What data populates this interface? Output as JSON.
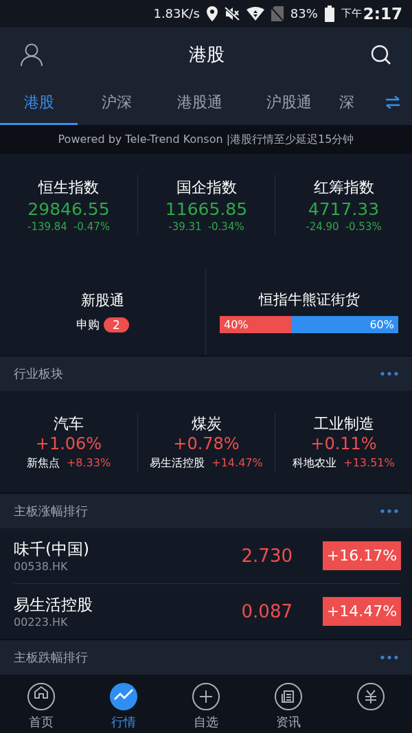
{
  "status_bar": {
    "speed": "1.83K/s",
    "battery": "83%",
    "period": "下午",
    "time": "2:17"
  },
  "header": {
    "title": "港股"
  },
  "tabs": [
    {
      "label": "港股",
      "selected": true
    },
    {
      "label": "沪深",
      "selected": false
    },
    {
      "label": "港股通",
      "selected": false
    },
    {
      "label": "沪股通",
      "selected": false
    },
    {
      "label": "深",
      "selected": false
    }
  ],
  "notice": "Powered by Tele-Trend Konson |港股行情至少延迟15分钟",
  "indices": [
    {
      "name": "恒生指数",
      "value": "29846.55",
      "change": "-139.84",
      "percent": "-0.47%",
      "kind": "down"
    },
    {
      "name": "国企指数",
      "value": "11665.85",
      "change": "-39.31",
      "percent": "-0.34%",
      "kind": "down"
    },
    {
      "name": "红筹指数",
      "value": "4717.33",
      "change": "-24.90",
      "percent": "-0.53%",
      "kind": "down"
    }
  ],
  "new_shares": {
    "title": "新股通",
    "label": "申购",
    "count": "2"
  },
  "bull_bear": {
    "title": "恒指牛熊证街货",
    "level": 0.4,
    "bull_label": "40%",
    "bear_label": "60%"
  },
  "sections": [
    {
      "title": "行业板块",
      "kind": "sectors",
      "items": [
        {
          "name": "汽车",
          "percent": "+1.06%",
          "leader": "新焦点",
          "leader_percent": "+8.33%",
          "kind": "up"
        },
        {
          "name": "煤炭",
          "percent": "+0.78%",
          "leader": "易生活控股",
          "leader_percent": "+14.47%",
          "kind": "up"
        },
        {
          "name": "工业制造",
          "percent": "+0.11%",
          "leader": "科地农业",
          "leader_percent": "+13.51%",
          "kind": "up"
        }
      ]
    },
    {
      "title": "主板涨幅排行",
      "kind": "stocks",
      "items": [
        {
          "name": "味千(中国)",
          "code": "00538.HK",
          "price": "2.730",
          "percent": "+16.17%",
          "kind": "up"
        },
        {
          "name": "易生活控股",
          "code": "00223.HK",
          "price": "0.087",
          "percent": "+14.47%",
          "kind": "up"
        }
      ]
    },
    {
      "title": "主板跌幅排行",
      "kind": "stocks"
    }
  ],
  "nav": [
    {
      "label": "首页",
      "selected": false
    },
    {
      "label": "行情",
      "selected": true
    },
    {
      "label": "自选",
      "selected": false
    },
    {
      "label": "资讯",
      "selected": false
    },
    {
      "selected": false
    }
  ]
}
